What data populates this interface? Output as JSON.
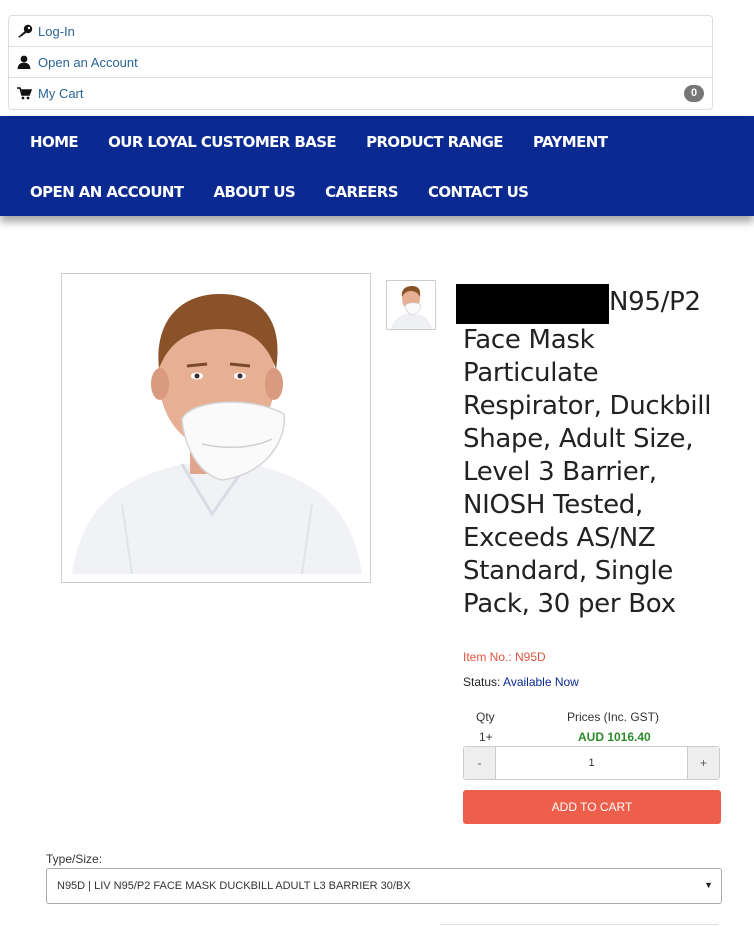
{
  "account": {
    "login_label": "Log-In",
    "open_account_label": "Open an Account",
    "cart_label": "My Cart",
    "cart_count": "0"
  },
  "nav": {
    "row1": [
      "HOME",
      "OUR LOYAL CUSTOMER BASE",
      "PRODUCT RANGE",
      "PAYMENT"
    ],
    "row2": [
      "OPEN AN ACCOUNT",
      "ABOUT US",
      "CAREERS",
      "CONTACT US"
    ]
  },
  "product": {
    "title_after_redaction": "N95/P2 Face Mask Particulate Respirator, Duckbill Shape, Adult Size, Level 3 Barrier, NIOSH Tested, Exceeds AS/NZ Standard, Single Pack, 30 per Box",
    "item_no": "Item No.: N95D",
    "status_label": "Status:",
    "status_value": "Available Now",
    "qty_header": "Qty",
    "price_header": "Prices (Inc. GST)",
    "qty_tier": "1+",
    "price_value": "AUD 1016.40",
    "qty_input": "1",
    "minus_label": "-",
    "plus_label": "+",
    "add_to_cart": "ADD TO CART",
    "type_label": "Type/Size:",
    "type_selected": "N95D | LIV N95/P2 FACE MASK DUCKBILL ADULT L3 BARRIER 30/BX"
  },
  "icons": {
    "login": "key-icon",
    "open_account": "user-icon",
    "cart": "cart-icon",
    "select": "caret-down-icon"
  },
  "colors": {
    "nav_bg": "#0a2a91",
    "link": "#2a6496",
    "accent_red": "#ee5f4b",
    "price_green": "#2a8a2a"
  }
}
